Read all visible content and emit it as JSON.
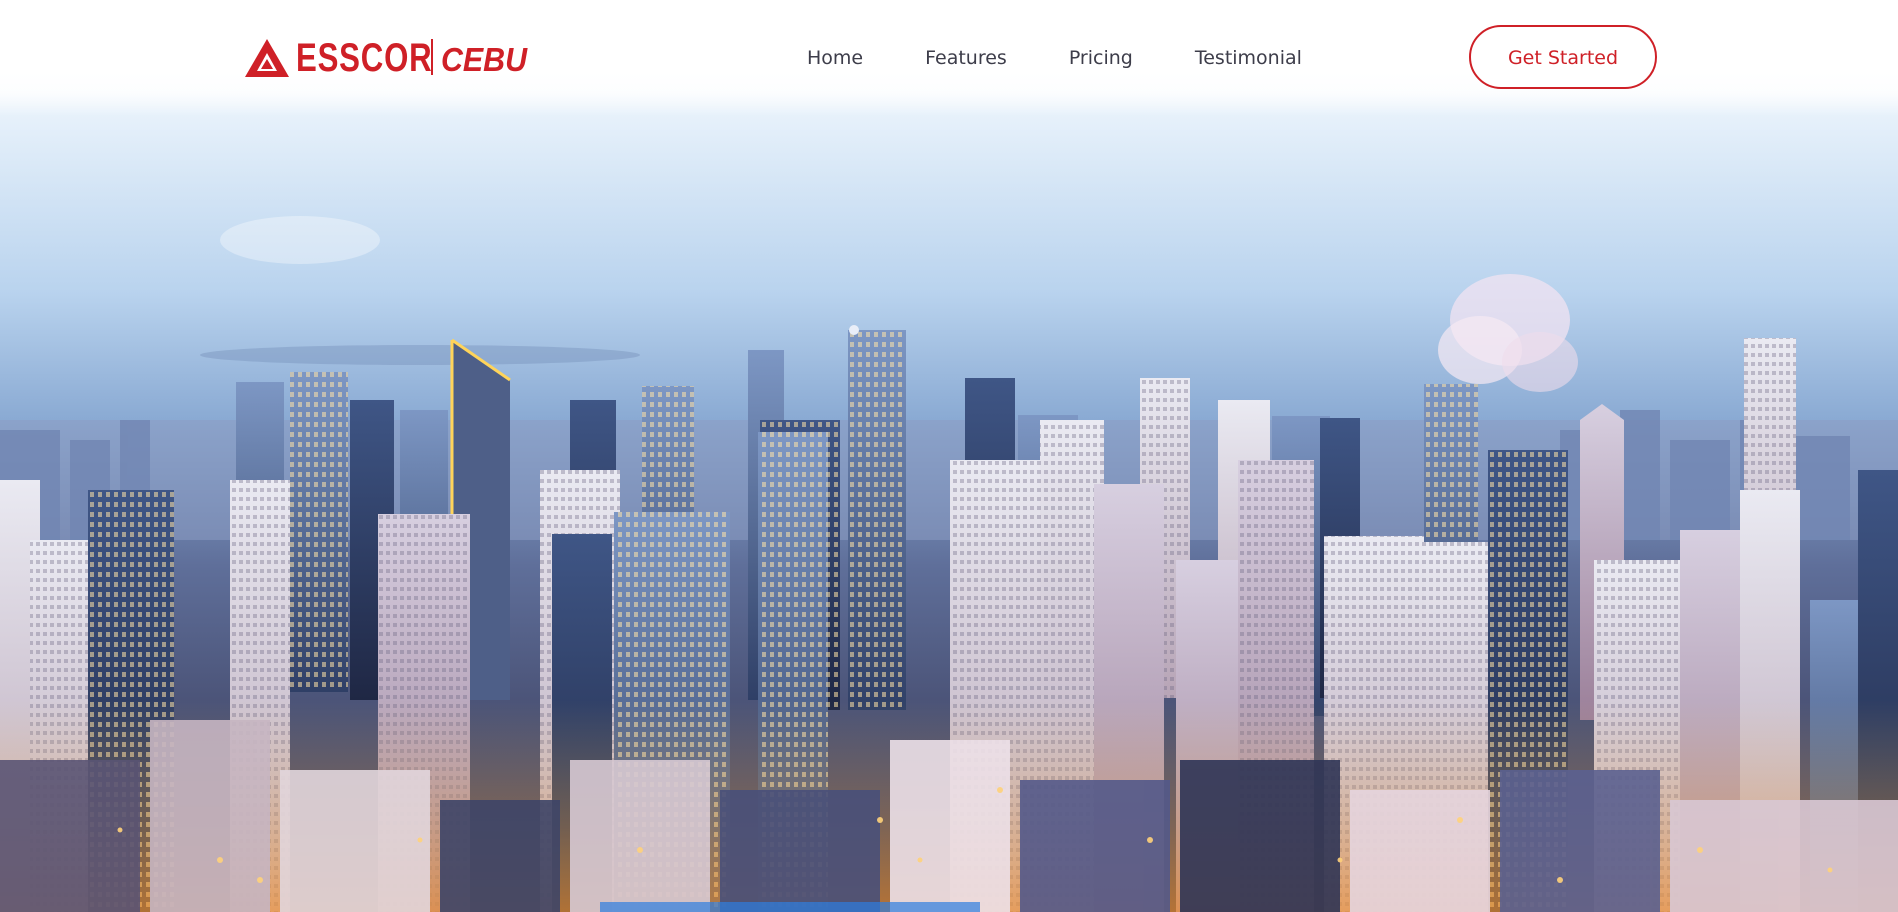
{
  "header": {
    "logo": {
      "brand": "ESSCOR",
      "sub": "CEBU",
      "icon": "triangle-mountain-icon"
    },
    "nav": {
      "items": [
        {
          "label": "Home"
        },
        {
          "label": "Features"
        },
        {
          "label": "Pricing"
        },
        {
          "label": "Testimonial"
        }
      ]
    },
    "cta_label": "Get Started"
  },
  "hero": {
    "image": "city-skyline-dusk"
  },
  "colors": {
    "brand": "#cf2027",
    "nav_text": "#3d3d4a",
    "sky_top": "#cfe3f7",
    "sky_bottom": "#7fa2cf"
  }
}
